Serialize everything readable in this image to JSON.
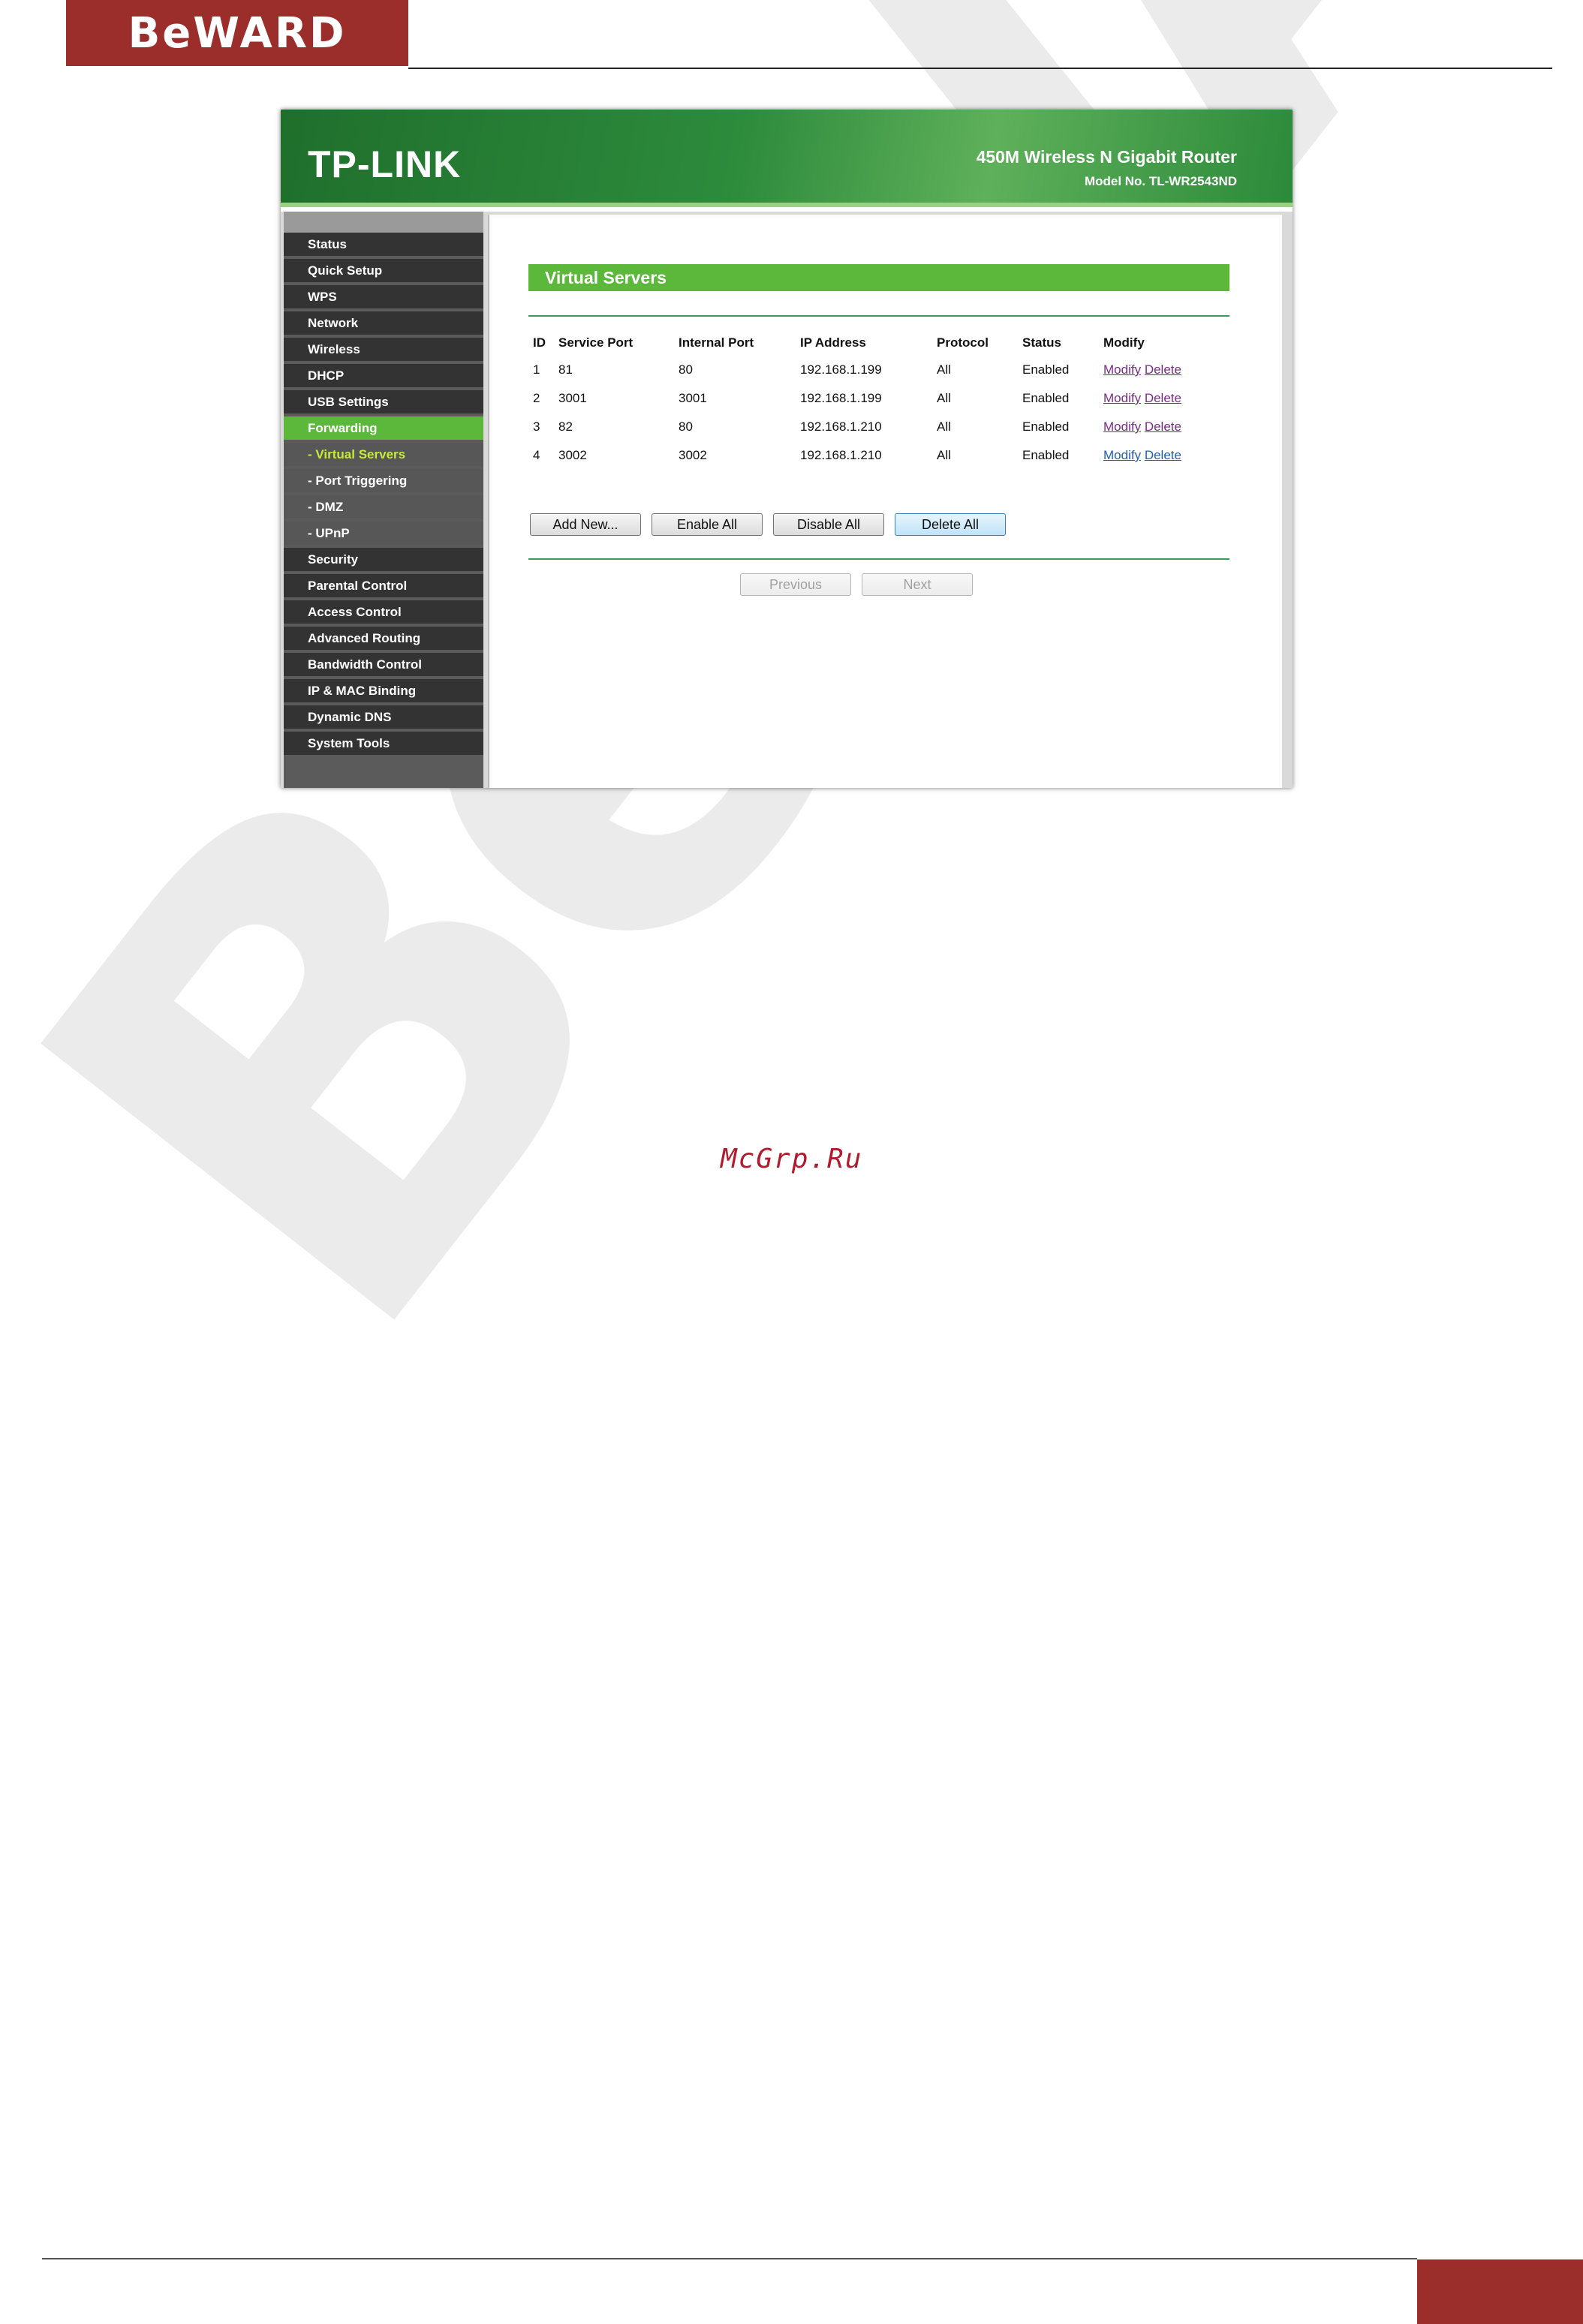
{
  "document": {
    "brand_logo": "BeWARD",
    "watermark": "BeWARD",
    "footer_site": "McGrp.Ru"
  },
  "router": {
    "brand": "TP-LINK",
    "model_title": "450M Wireless N Gigabit Router",
    "model_number": "Model No. TL-WR2543ND",
    "menu": [
      {
        "label": "Status"
      },
      {
        "label": "Quick Setup"
      },
      {
        "label": "WPS"
      },
      {
        "label": "Network"
      },
      {
        "label": "Wireless"
      },
      {
        "label": "DHCP"
      },
      {
        "label": "USB Settings"
      },
      {
        "label": "Forwarding"
      },
      {
        "label": "- Virtual Servers"
      },
      {
        "label": "- Port Triggering"
      },
      {
        "label": "- DMZ"
      },
      {
        "label": "- UPnP"
      },
      {
        "label": "Security"
      },
      {
        "label": "Parental Control"
      },
      {
        "label": "Access Control"
      },
      {
        "label": "Advanced Routing"
      },
      {
        "label": "Bandwidth Control"
      },
      {
        "label": "IP & MAC Binding"
      },
      {
        "label": "Dynamic DNS"
      },
      {
        "label": "System Tools"
      }
    ],
    "page_title": "Virtual Servers",
    "table": {
      "headers": [
        "ID",
        "Service Port",
        "Internal Port",
        "IP Address",
        "Protocol",
        "Status",
        "Modify"
      ],
      "rows": [
        {
          "id": "1",
          "service_port": "81",
          "internal_port": "80",
          "ip": "192.168.1.199",
          "protocol": "All",
          "status": "Enabled",
          "modify": "Modify",
          "delete": "Delete"
        },
        {
          "id": "2",
          "service_port": "3001",
          "internal_port": "3001",
          "ip": "192.168.1.199",
          "protocol": "All",
          "status": "Enabled",
          "modify": "Modify",
          "delete": "Delete"
        },
        {
          "id": "3",
          "service_port": "82",
          "internal_port": "80",
          "ip": "192.168.1.210",
          "protocol": "All",
          "status": "Enabled",
          "modify": "Modify",
          "delete": "Delete"
        },
        {
          "id": "4",
          "service_port": "3002",
          "internal_port": "3002",
          "ip": "192.168.1.210",
          "protocol": "All",
          "status": "Enabled",
          "modify": "Modify",
          "delete": "Delete"
        }
      ]
    },
    "buttons": {
      "add_new": "Add New...",
      "enable_all": "Enable All",
      "disable_all": "Disable All",
      "delete_all": "Delete All",
      "previous": "Previous",
      "next": "Next"
    },
    "colors": {
      "header_green": "#2d8b3c",
      "accent_green": "#5cb83a",
      "sidebar_dark": "#333333",
      "sub_active_text": "#c6ea3a",
      "brand_red": "#9b2d2b"
    }
  }
}
